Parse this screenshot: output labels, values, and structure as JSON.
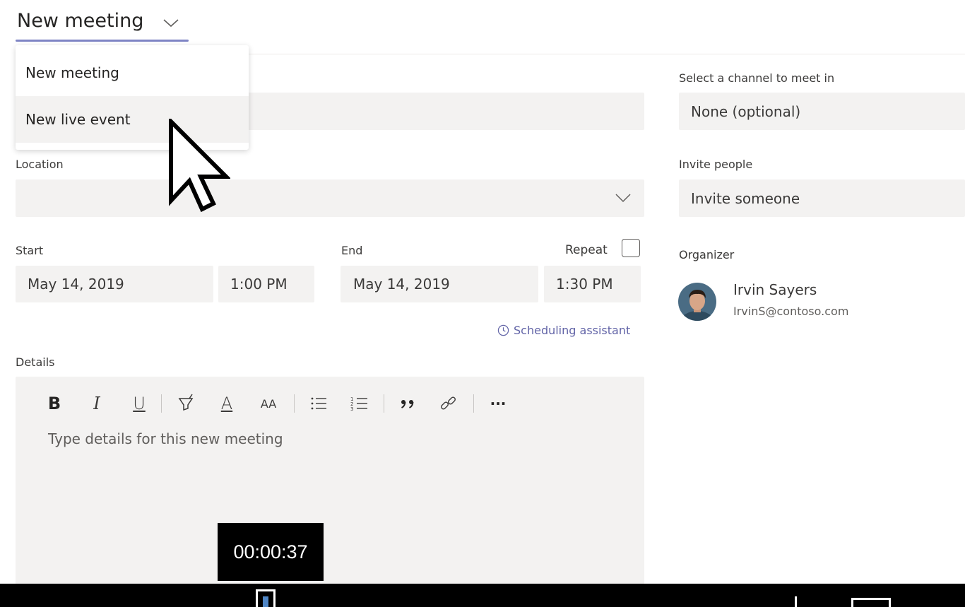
{
  "header": {
    "title": "New meeting",
    "menu": {
      "items": [
        {
          "label": "New meeting"
        },
        {
          "label": "New live event"
        }
      ]
    }
  },
  "form": {
    "location": {
      "label": "Location",
      "value": ""
    },
    "start": {
      "label": "Start",
      "date": "May 14, 2019",
      "time": "1:00 PM"
    },
    "end": {
      "label": "End",
      "date": "May 14, 2019",
      "time": "1:30 PM"
    },
    "repeat": {
      "label": "Repeat",
      "checked": false
    },
    "scheduling_assistant": "Scheduling assistant",
    "details": {
      "label": "Details",
      "placeholder": "Type details for this new meeting",
      "toolbar": {
        "bold": "B",
        "italic": "I",
        "underline": "U",
        "font_color": "A",
        "font_size": "AA",
        "more": "···"
      }
    }
  },
  "sidebar": {
    "channel": {
      "label": "Select a channel to meet in",
      "placeholder": "None (optional)"
    },
    "invite": {
      "label": "Invite people",
      "placeholder": "Invite someone"
    },
    "organizer": {
      "label": "Organizer",
      "name": "Irvin Sayers",
      "email": "IrvinS@contoso.com"
    }
  },
  "overlay": {
    "timer": "00:00:37"
  },
  "colors": {
    "accent": "#7f85c5",
    "field_bg": "#f3f2f1",
    "link": "#6264a7"
  }
}
